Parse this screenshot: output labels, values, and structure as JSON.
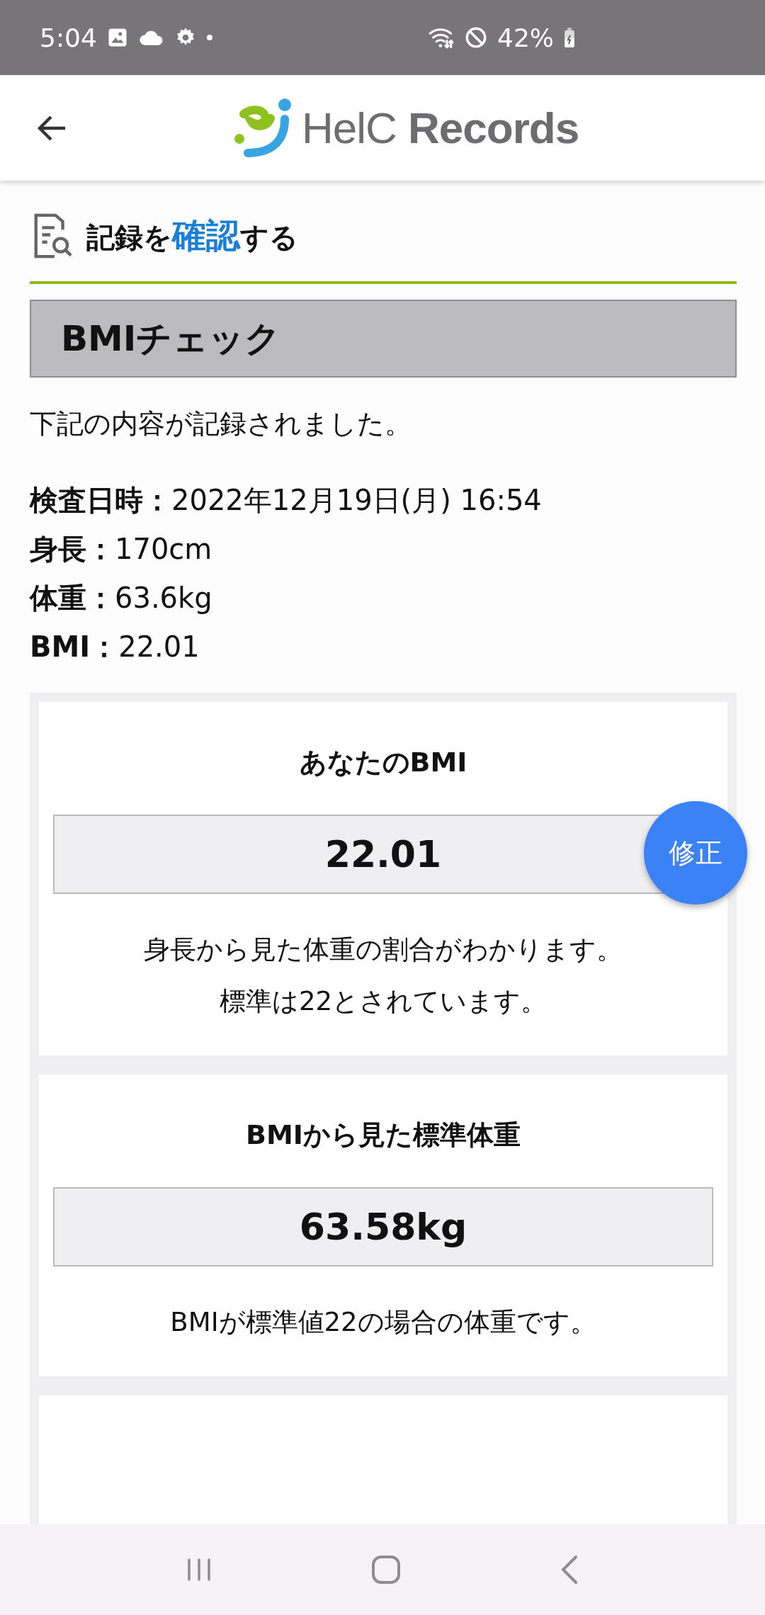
{
  "status_bar": {
    "time": "5:04",
    "battery": "42%"
  },
  "header": {
    "logo": "HelC **Records**"
  },
  "section_title": {
    "before": "記録を",
    "highlight": "確認",
    "after": "する"
  },
  "check_title": "BMIチェック",
  "message": "下記の内容が記録されました。",
  "details": [
    {
      "label": "検査日時：",
      "value": "2022年12月19日(月) 16:54"
    },
    {
      "label": "身長：",
      "value": "170cm"
    },
    {
      "label": "体重：",
      "value": "63.6kg"
    },
    {
      "label": "BMI：",
      "value": "22.01"
    }
  ],
  "cards": [
    {
      "kind": "result",
      "title": "あなたのBMI",
      "value": "22.01",
      "description": [
        "身長から見た体重の割合がわかります。",
        "標準は22とされています。"
      ]
    },
    {
      "kind": "result",
      "title": "BMIから見た標準体重",
      "value": "63.58kg",
      "description": [
        "BMIが標準値22の場合の体重です。"
      ]
    },
    {
      "kind": "result"
    }
  ],
  "fab": {
    "label": "修正"
  }
}
